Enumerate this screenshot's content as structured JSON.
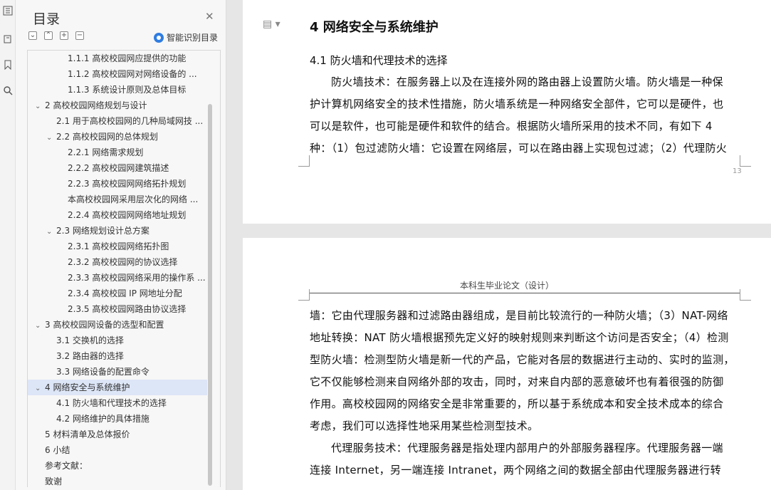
{
  "toc": {
    "title": "目录",
    "smart_label": "智能识别目录",
    "items": [
      {
        "level": 3,
        "label": "1.1.1  高校校园网应提供的功能",
        "chev": ""
      },
      {
        "level": 3,
        "label": "1.1.2  高校校园网对网络设备的 ...",
        "chev": ""
      },
      {
        "level": 3,
        "label": "1.1.3  系统设计原则及总体目标",
        "chev": ""
      },
      {
        "level": 1,
        "label": "2  高校校园网络规划与设计",
        "chev": "⌄"
      },
      {
        "level": 2,
        "label": "2.1  用于高校校园网的几种局域网技 ...",
        "chev": ""
      },
      {
        "level": 2,
        "label": "2.2  高校校园网的总体规划",
        "chev": "⌄"
      },
      {
        "level": 3,
        "label": "2.2.1  网络需求规划",
        "chev": ""
      },
      {
        "level": 3,
        "label": "2.2.2  高校校园网建筑描述",
        "chev": ""
      },
      {
        "level": 3,
        "label": "2.2.3  高校校园网网络拓扑规划",
        "chev": ""
      },
      {
        "level": 3,
        "label": "本高校校园网采用层次化的网络 ...",
        "chev": ""
      },
      {
        "level": 3,
        "label": "2.2.4  高校校园网网络地址规划",
        "chev": ""
      },
      {
        "level": 2,
        "label": "2.3  网络规划设计总方案",
        "chev": "⌄"
      },
      {
        "level": 3,
        "label": "2.3.1  高校校园网络拓扑图",
        "chev": ""
      },
      {
        "level": 3,
        "label": "2.3.2  高校校园网的协议选择",
        "chev": ""
      },
      {
        "level": 3,
        "label": "2.3.3 高校校园网络采用的操作系 ...",
        "chev": ""
      },
      {
        "level": 3,
        "label": "2.3.4  高校校园 IP 网地址分配",
        "chev": ""
      },
      {
        "level": 3,
        "label": "2.3.5  高校校园网路由协议选择",
        "chev": ""
      },
      {
        "level": 1,
        "label": "3  高校校园网设备的选型和配置",
        "chev": "⌄"
      },
      {
        "level": 2,
        "label": "3.1  交换机的选择",
        "chev": ""
      },
      {
        "level": 2,
        "label": "3.2  路由器的选择",
        "chev": ""
      },
      {
        "level": 2,
        "label": "3.3  网络设备的配置命令",
        "chev": ""
      },
      {
        "level": 1,
        "label": "4  网络安全与系统维护",
        "chev": "⌄",
        "active": true
      },
      {
        "level": 2,
        "label": "4.1  防火墙和代理技术的选择",
        "chev": ""
      },
      {
        "level": 2,
        "label": "4.2  网络维护的具体措施",
        "chev": ""
      },
      {
        "level": 1,
        "label": "5  材料清单及总体报价",
        "chev": ""
      },
      {
        "level": 1,
        "label": "6  小结",
        "chev": ""
      },
      {
        "level": 1,
        "label": "参考文献：",
        "chev": ""
      },
      {
        "level": 1,
        "label": "致谢",
        "chev": ""
      }
    ]
  },
  "page1": {
    "heading": "4  网络安全与系统维护",
    "subheading": "4.1  防火墙和代理技术的选择",
    "lines": [
      "防火墙技术：在服务器上以及在连接外网的路由器上设置防火墙。防火墙是一种保",
      "护计算机网络安全的技术性措施，防火墙系统是一种网络安全部件，它可以是硬件，也",
      "可以是软件，也可能是硬件和软件的结合。根据防火墙所采用的技术不同，有如下 4",
      "种：（1）包过滤防火墙：它设置在网络层，可以在路由器上实现包过滤；（2）代理防火"
    ],
    "page_number": "13"
  },
  "page2": {
    "header": "本科生毕业论文（设计）",
    "lines": [
      "墙：它由代理服务器和过滤路由器组成，是目前比较流行的一种防火墙；（3）NAT-网络",
      "地址转换：NAT 防火墙根据预先定义好的映射规则来判断这个访问是否安全；（4）检测",
      "型防火墙：检测型防火墙是新一代的产品，它能对各层的数据进行主动的、实时的监测，",
      "它不仅能够检测来自网络外部的攻击，同时，对来自内部的恶意破坏也有着很强的防御",
      "作用。高校校园网的网络安全是非常重要的，所以基于系统成本和安全技术成本的综合",
      "考虑，我们可以选择性地采用某些检测型技术。",
      "代理服务技术：代理服务器是指处理内部用户的外部服务器程序。代理服务器一端",
      "连接 Internet，另一端连接 Intranet，两个网络之间的数据全部由代理服务器进行转"
    ]
  }
}
